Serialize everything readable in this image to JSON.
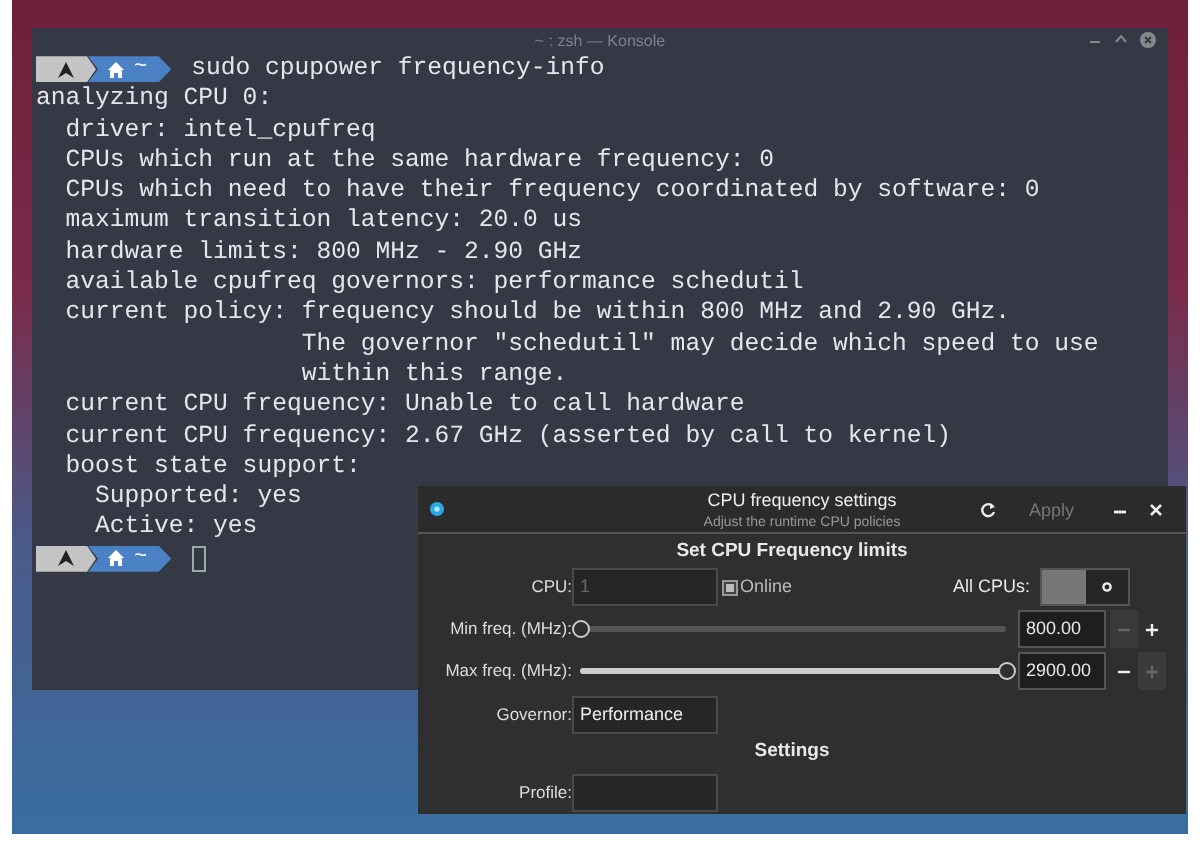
{
  "terminal": {
    "title": "~ : zsh — Konsole",
    "prompt": {
      "path": "~"
    },
    "command": "sudo cpupower frequency-info",
    "output": [
      "analyzing CPU 0:",
      "  driver: intel_cpufreq",
      "  CPUs which run at the same hardware frequency: 0",
      "  CPUs which need to have their frequency coordinated by software: 0",
      "  maximum transition latency: 20.0 us",
      "  hardware limits: 800 MHz - 2.90 GHz",
      "  available cpufreq governors: performance schedutil",
      "  current policy: frequency should be within 800 MHz and 2.90 GHz.",
      "                  The governor \"schedutil\" may decide which speed to use",
      "                  within this range.",
      "  current CPU frequency: Unable to call hardware",
      "  current CPU frequency: 2.67 GHz (asserted by call to kernel)",
      "  boost state support:",
      "    Supported: yes",
      "    Active: yes"
    ],
    "next_prompt": {
      "path": "~"
    }
  },
  "dialog": {
    "title": "CPU frequency settings",
    "subtitle": "Adjust the runtime CPU policies",
    "apply": {
      "label": "Apply",
      "disabled": true
    },
    "limits_heading": "Set CPU Frequency limits",
    "cpu": {
      "label": "CPU:",
      "value": "1",
      "disabled": true
    },
    "online": {
      "label": "Online",
      "checked": true,
      "disabled": true
    },
    "all_cpus": {
      "label": "All CPUs:",
      "on": false
    },
    "sliders": [
      {
        "label": "Min freq. (MHz):",
        "level": 0,
        "value": "800.00",
        "minus_disabled": true,
        "plus_disabled": false
      },
      {
        "label": "Max freq. (MHz):",
        "level": 1,
        "value": "2900.00",
        "minus_disabled": false,
        "plus_disabled": true
      }
    ],
    "governor": {
      "label": "Governor:",
      "value": "Performance"
    },
    "settings_heading": "Settings",
    "profile": {
      "label": "Profile:"
    }
  }
}
